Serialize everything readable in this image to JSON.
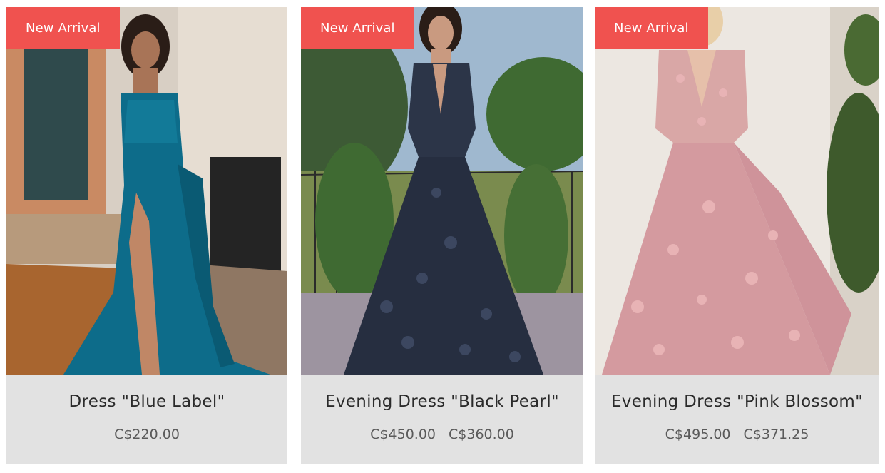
{
  "products": [
    {
      "badge": "New Arrival",
      "title": "Dress \"Blue Label\"",
      "old_price": "",
      "price": "C$220.00",
      "image": "teal-satin-gown-photo"
    },
    {
      "badge": "New Arrival",
      "title": "Evening Dress \"Black Pearl\"",
      "old_price": "C$450.00",
      "price": "C$360.00",
      "image": "navy-floral-ball-gown-photo"
    },
    {
      "badge": "New Arrival",
      "title": "Evening Dress \"Pink Blossom\"",
      "old_price": "C$495.00",
      "price": "C$371.25",
      "image": "pink-floral-ball-gown-photo"
    }
  ],
  "colors": {
    "badge": "#f0524f",
    "card_info_bg": "#e2e2e2",
    "title_text": "#2b2b2b",
    "price_text": "#5a5a5a"
  }
}
